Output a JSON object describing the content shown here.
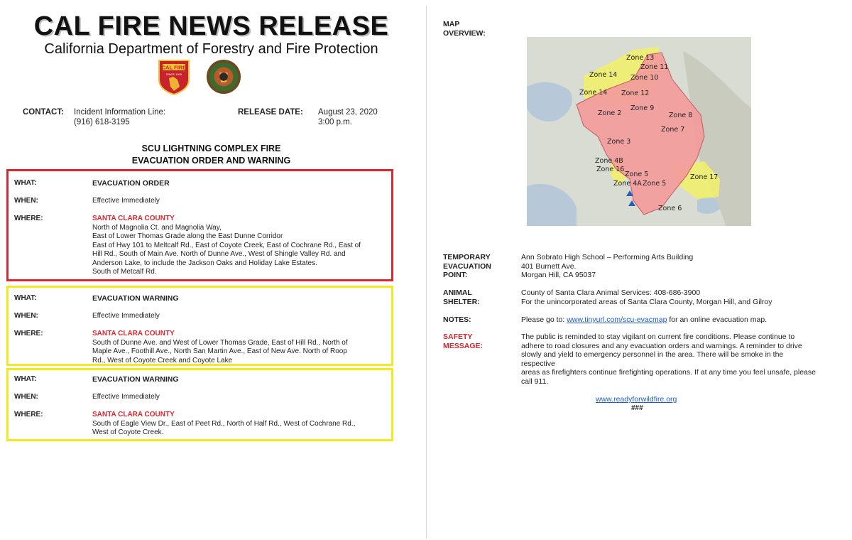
{
  "header": {
    "title": "CAL FIRE NEWS RELEASE",
    "subtitle": "California Department of Forestry and Fire Protection",
    "seal_left_text": "CAL FIRE",
    "seal_left_subtext": "SINCE 1905"
  },
  "contact": {
    "label": "CONTACT:",
    "line1": "Incident Information Line:",
    "line2": "(916) 618-3195",
    "release_label": "RELEASE DATE:",
    "date": "August 23, 2020",
    "time": "3:00  p.m."
  },
  "incident": {
    "line1": "SCU LIGHTNING COMPLEX FIRE",
    "line2": "EVACUATION ORDER AND WARNING"
  },
  "labels": {
    "what": "WHAT:",
    "when": "WHEN:",
    "where": "WHERE:"
  },
  "orders": [
    {
      "what": "EVACUATION ORDER",
      "when": "Effective Immediately",
      "county": "SANTA CLARA COUNTY",
      "where_lines": [
        "North of Magnolia Ct. and Magnolia Way,",
        "East of Lower Thomas Grade along the East Dunne Corridor",
        "East of Hwy 101 to Meltcalf Rd., East of Coyote Creek, East of Cochrane Rd., East of",
        "Hill Rd., South of Main Ave. North of Dunne Ave., West of Shingle Valley Rd. and",
        "Anderson Lake, to include the Jackson Oaks and Holiday Lake Estates.",
        "South of Metcalf Rd."
      ]
    },
    {
      "what": "EVACUATION WARNING",
      "when": "Effective Immediately",
      "county": "SANTA CLARA COUNTY",
      "where_lines": [
        "South of Dunne Ave. and West of Lower Thomas Grade, East of Hill Rd., North of",
        "Maple Ave., Foothill Ave., North San Martin Ave., East of New Ave. North of Roop",
        "Rd., West of Coyote Creek and Coyote Lake"
      ]
    },
    {
      "what": "EVACUATION WARNING",
      "when": "Effective Immediately",
      "county": "SANTA CLARA COUNTY",
      "where_lines": [
        "South of Eagle View Dr., East of Peet Rd., North of Half Rd., West of Cochrane Rd.,",
        "West of Coyote Creek."
      ]
    }
  ],
  "right": {
    "map_label_1": "MAP",
    "map_label_2": "OVERVIEW:",
    "zones": [
      "Zone 13",
      "Zone 11",
      "Zone 14",
      "Zone 10",
      "Zone 14",
      "Zone 12",
      "Zone 9",
      "Zone 2",
      "Zone 8",
      "Zone 7",
      "Zone 3",
      "Zone 4B",
      "Zone 16",
      "Zone 5",
      "Zone 17",
      "Zone 4A",
      "Zone 5",
      "Zone 6"
    ],
    "evac_point": {
      "label_1": "TEMPORARY",
      "label_2": "EVACUATION",
      "label_3": "POINT:",
      "line1": "Ann Sobrato High School – Performing Arts Building",
      "line2": "401 Burnett Ave.",
      "line3": "Morgan Hill, CA 95037"
    },
    "animal": {
      "label_1": "ANIMAL",
      "label_2": "SHELTER:",
      "line1": "County of Santa Clara Animal Services: 408-686-3900",
      "line2": "For the unincorporated areas of Santa Clara County, Morgan Hill, and Gilroy"
    },
    "notes": {
      "label": "NOTES:",
      "prefix": "Please go to: ",
      "link": "www.tinyurl.com/scu-evacmap",
      "suffix": " for an online evacuation map."
    },
    "safety": {
      "label_1": "SAFETY",
      "label_2": "MESSAGE:",
      "lines": [
        "The public is reminded to stay vigilant on current fire conditions. Please continue to",
        "adhere to road closures and any evacuation orders and warnings. A reminder to drive",
        "slowly and yield to emergency personnel in the area.  There will be smoke in the respective",
        "areas as firefighters continue firefighting operations. If at any time you feel unsafe, please",
        "call 911."
      ]
    },
    "footer_link": "www.readyforwildfire.org",
    "footer_end": "###"
  },
  "colors": {
    "order_border": "#e0252c",
    "warning_border": "#f4e91a",
    "county_text": "#e0252c",
    "link": "#1f5bd0"
  }
}
